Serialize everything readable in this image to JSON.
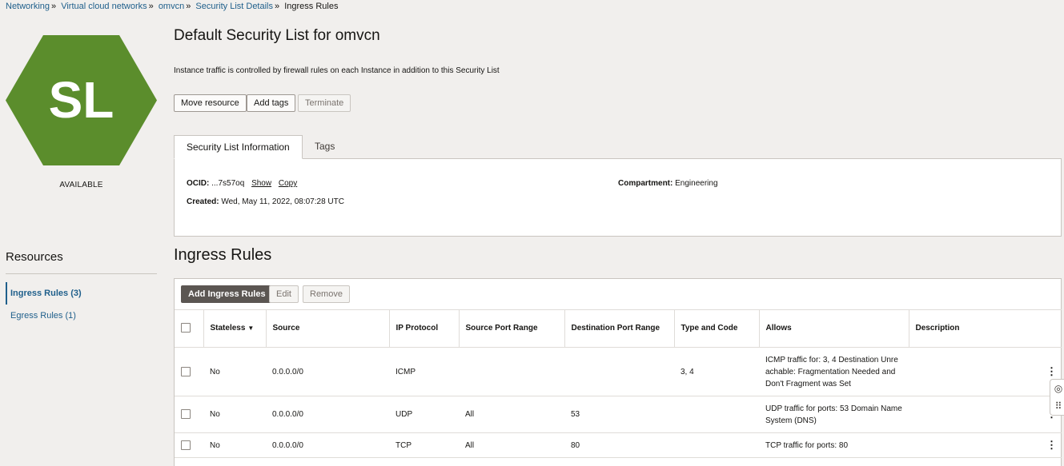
{
  "breadcrumb": {
    "items": [
      "Networking",
      "Virtual cloud networks",
      "omvcn",
      "Security List Details"
    ],
    "current": "Ingress Rules"
  },
  "badge": {
    "initials": "SL",
    "color": "#5b8d2c"
  },
  "status": "AVAILABLE",
  "title": "Default Security List for omvcn",
  "description": "Instance traffic is controlled by firewall rules on each Instance in addition to this Security List",
  "actions": {
    "move": "Move resource",
    "tags": "Add tags",
    "terminate": "Terminate"
  },
  "tabs": {
    "info": "Security List Information",
    "tags": "Tags"
  },
  "info": {
    "ocid_label": "OCID:",
    "ocid_value": "...7s57oq",
    "show": "Show",
    "copy": "Copy",
    "created_label": "Created:",
    "created_value": "Wed, May 11, 2022, 08:07:28 UTC",
    "compartment_label": "Compartment:",
    "compartment_value": "Engineering"
  },
  "resources": {
    "title": "Resources",
    "items": [
      "Ingress Rules (3)",
      "Egress Rules (1)"
    ]
  },
  "section_title": "Ingress Rules",
  "table_actions": {
    "add": "Add Ingress Rules",
    "edit": "Edit",
    "remove": "Remove"
  },
  "table": {
    "headers": [
      "Stateless",
      "Source",
      "IP Protocol",
      "Source Port Range",
      "Destination Port Range",
      "Type and Code",
      "Allows",
      "Description"
    ],
    "rows": [
      {
        "stateless": "No",
        "source": "0.0.0.0/0",
        "protocol": "ICMP",
        "src_port": "",
        "dst_port": "",
        "type_code": "3, 4",
        "allows": "ICMP traffic for: 3, 4 Destination Unreachable: Fragmentation Needed and Don't Fragment was Set",
        "description": ""
      },
      {
        "stateless": "No",
        "source": "0.0.0.0/0",
        "protocol": "UDP",
        "src_port": "All",
        "dst_port": "53",
        "type_code": "",
        "allows": "UDP traffic for ports: 53 Domain Name System (DNS)",
        "description": ""
      },
      {
        "stateless": "No",
        "source": "0.0.0.0/0",
        "protocol": "TCP",
        "src_port": "All",
        "dst_port": "80",
        "type_code": "",
        "allows": "TCP traffic for ports: 80",
        "description": ""
      }
    ]
  },
  "icons": {
    "sort": "caret-down-icon",
    "kebab": "kebab-menu-icon",
    "help": "help-lifebuoy-icon"
  }
}
